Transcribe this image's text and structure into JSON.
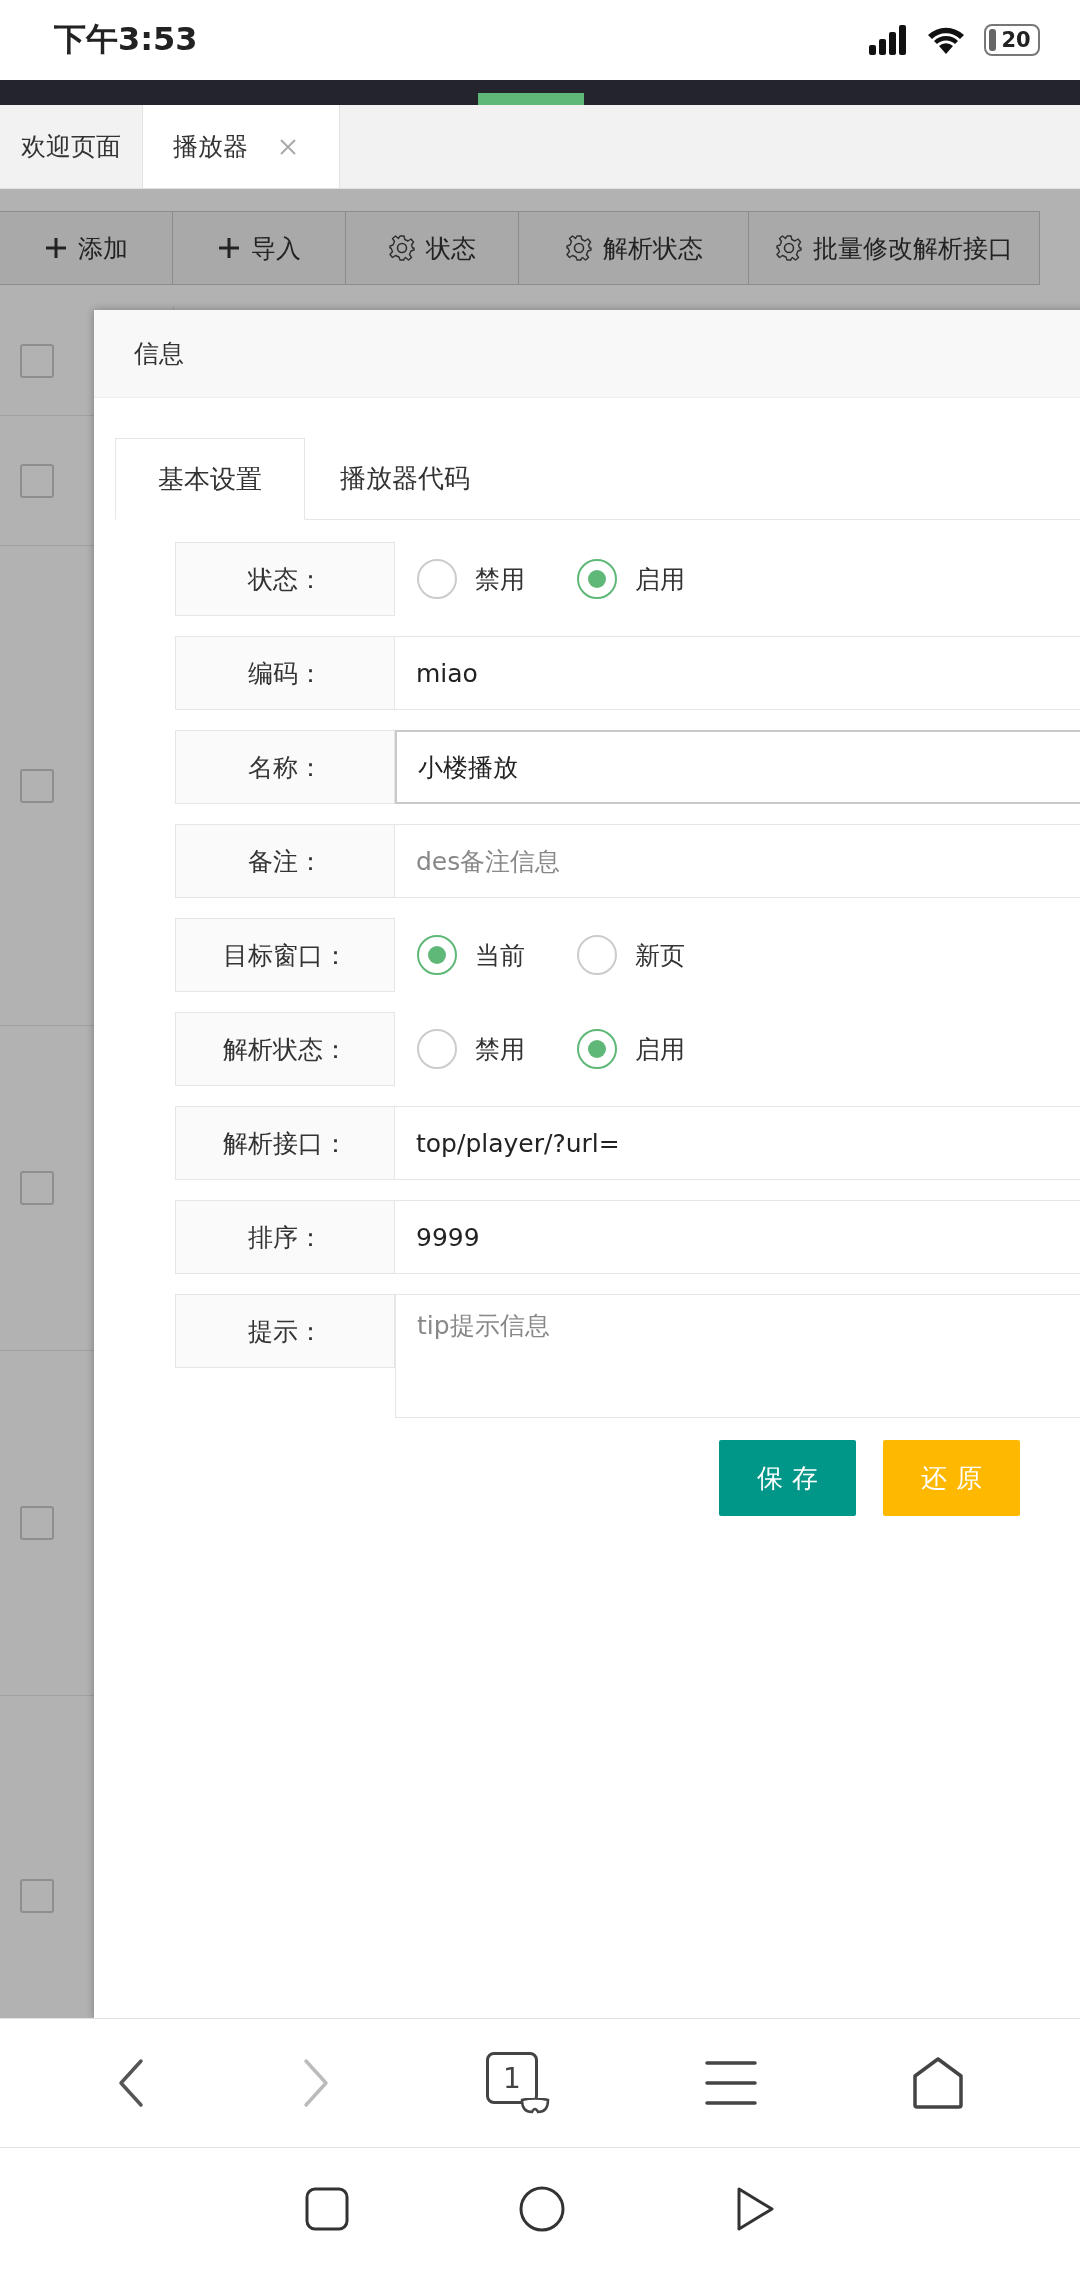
{
  "status_bar": {
    "time": "下午3:53",
    "battery": "20"
  },
  "page_tabs": [
    {
      "label": "欢迎页面",
      "selected": false,
      "closable": false
    },
    {
      "label": "播放器",
      "selected": true,
      "closable": true
    }
  ],
  "toolbar": [
    {
      "label": "添加",
      "kind": "add"
    },
    {
      "label": "导入",
      "kind": "add"
    },
    {
      "label": "状态",
      "kind": "settings"
    },
    {
      "label": "解析状态",
      "kind": "settings"
    },
    {
      "label": "批量修改解析接口",
      "kind": "settings"
    }
  ],
  "table_rows": [
    {
      "checked": false
    },
    {
      "checked": false
    },
    {
      "checked": false
    },
    {
      "checked": false
    },
    {
      "checked": false
    },
    {
      "checked": false
    }
  ],
  "dialog": {
    "title": "信息",
    "tabs": [
      {
        "label": "基本设置",
        "selected": true
      },
      {
        "label": "播放器代码",
        "selected": false
      }
    ],
    "fields": [
      {
        "label": "状态：",
        "kind": "radio",
        "options": [
          {
            "label": "禁用",
            "selected": false
          },
          {
            "label": "启用",
            "selected": true
          }
        ]
      },
      {
        "label": "编码：",
        "kind": "text",
        "value": "miao",
        "focused": false
      },
      {
        "label": "名称：",
        "kind": "text",
        "value": "小楼播放",
        "focused": true
      },
      {
        "label": "备注：",
        "kind": "text",
        "placeholder": "des备注信息",
        "focused": false
      },
      {
        "label": "目标窗口：",
        "kind": "radio",
        "options": [
          {
            "label": "当前",
            "selected": true
          },
          {
            "label": "新页",
            "selected": false
          }
        ]
      },
      {
        "label": "解析状态：",
        "kind": "radio",
        "options": [
          {
            "label": "禁用",
            "selected": false
          },
          {
            "label": "启用",
            "selected": true
          }
        ]
      },
      {
        "label": "解析接口：",
        "kind": "text",
        "value": "top/player/?url=",
        "focused": false
      },
      {
        "label": "排序：",
        "kind": "text",
        "value": "9999",
        "focused": false
      },
      {
        "label": "提示：",
        "kind": "textarea",
        "placeholder": "tip提示信息",
        "focused": false
      }
    ],
    "buttons": [
      {
        "label": "保 存",
        "kind": "primary"
      },
      {
        "label": "还 原",
        "kind": "warning"
      }
    ]
  },
  "browser_bar": {
    "tab_count": "1"
  }
}
